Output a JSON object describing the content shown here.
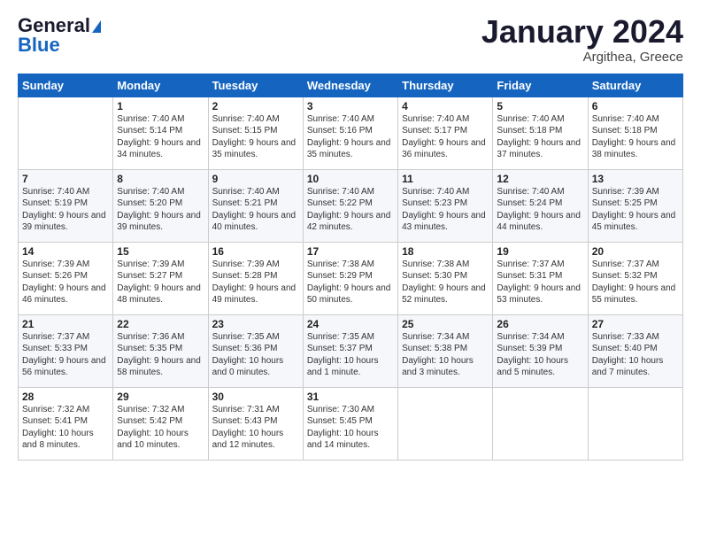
{
  "header": {
    "logo_general": "General",
    "logo_blue": "Blue",
    "month_title": "January 2024",
    "location": "Argithea, Greece"
  },
  "weekdays": [
    "Sunday",
    "Monday",
    "Tuesday",
    "Wednesday",
    "Thursday",
    "Friday",
    "Saturday"
  ],
  "weeks": [
    [
      {
        "day": "",
        "sunrise": "",
        "sunset": "",
        "daylight": ""
      },
      {
        "day": "1",
        "sunrise": "Sunrise: 7:40 AM",
        "sunset": "Sunset: 5:14 PM",
        "daylight": "Daylight: 9 hours and 34 minutes."
      },
      {
        "day": "2",
        "sunrise": "Sunrise: 7:40 AM",
        "sunset": "Sunset: 5:15 PM",
        "daylight": "Daylight: 9 hours and 35 minutes."
      },
      {
        "day": "3",
        "sunrise": "Sunrise: 7:40 AM",
        "sunset": "Sunset: 5:16 PM",
        "daylight": "Daylight: 9 hours and 35 minutes."
      },
      {
        "day": "4",
        "sunrise": "Sunrise: 7:40 AM",
        "sunset": "Sunset: 5:17 PM",
        "daylight": "Daylight: 9 hours and 36 minutes."
      },
      {
        "day": "5",
        "sunrise": "Sunrise: 7:40 AM",
        "sunset": "Sunset: 5:18 PM",
        "daylight": "Daylight: 9 hours and 37 minutes."
      },
      {
        "day": "6",
        "sunrise": "Sunrise: 7:40 AM",
        "sunset": "Sunset: 5:18 PM",
        "daylight": "Daylight: 9 hours and 38 minutes."
      }
    ],
    [
      {
        "day": "7",
        "sunrise": "Sunrise: 7:40 AM",
        "sunset": "Sunset: 5:19 PM",
        "daylight": "Daylight: 9 hours and 39 minutes."
      },
      {
        "day": "8",
        "sunrise": "Sunrise: 7:40 AM",
        "sunset": "Sunset: 5:20 PM",
        "daylight": "Daylight: 9 hours and 39 minutes."
      },
      {
        "day": "9",
        "sunrise": "Sunrise: 7:40 AM",
        "sunset": "Sunset: 5:21 PM",
        "daylight": "Daylight: 9 hours and 40 minutes."
      },
      {
        "day": "10",
        "sunrise": "Sunrise: 7:40 AM",
        "sunset": "Sunset: 5:22 PM",
        "daylight": "Daylight: 9 hours and 42 minutes."
      },
      {
        "day": "11",
        "sunrise": "Sunrise: 7:40 AM",
        "sunset": "Sunset: 5:23 PM",
        "daylight": "Daylight: 9 hours and 43 minutes."
      },
      {
        "day": "12",
        "sunrise": "Sunrise: 7:40 AM",
        "sunset": "Sunset: 5:24 PM",
        "daylight": "Daylight: 9 hours and 44 minutes."
      },
      {
        "day": "13",
        "sunrise": "Sunrise: 7:39 AM",
        "sunset": "Sunset: 5:25 PM",
        "daylight": "Daylight: 9 hours and 45 minutes."
      }
    ],
    [
      {
        "day": "14",
        "sunrise": "Sunrise: 7:39 AM",
        "sunset": "Sunset: 5:26 PM",
        "daylight": "Daylight: 9 hours and 46 minutes."
      },
      {
        "day": "15",
        "sunrise": "Sunrise: 7:39 AM",
        "sunset": "Sunset: 5:27 PM",
        "daylight": "Daylight: 9 hours and 48 minutes."
      },
      {
        "day": "16",
        "sunrise": "Sunrise: 7:39 AM",
        "sunset": "Sunset: 5:28 PM",
        "daylight": "Daylight: 9 hours and 49 minutes."
      },
      {
        "day": "17",
        "sunrise": "Sunrise: 7:38 AM",
        "sunset": "Sunset: 5:29 PM",
        "daylight": "Daylight: 9 hours and 50 minutes."
      },
      {
        "day": "18",
        "sunrise": "Sunrise: 7:38 AM",
        "sunset": "Sunset: 5:30 PM",
        "daylight": "Daylight: 9 hours and 52 minutes."
      },
      {
        "day": "19",
        "sunrise": "Sunrise: 7:37 AM",
        "sunset": "Sunset: 5:31 PM",
        "daylight": "Daylight: 9 hours and 53 minutes."
      },
      {
        "day": "20",
        "sunrise": "Sunrise: 7:37 AM",
        "sunset": "Sunset: 5:32 PM",
        "daylight": "Daylight: 9 hours and 55 minutes."
      }
    ],
    [
      {
        "day": "21",
        "sunrise": "Sunrise: 7:37 AM",
        "sunset": "Sunset: 5:33 PM",
        "daylight": "Daylight: 9 hours and 56 minutes."
      },
      {
        "day": "22",
        "sunrise": "Sunrise: 7:36 AM",
        "sunset": "Sunset: 5:35 PM",
        "daylight": "Daylight: 9 hours and 58 minutes."
      },
      {
        "day": "23",
        "sunrise": "Sunrise: 7:35 AM",
        "sunset": "Sunset: 5:36 PM",
        "daylight": "Daylight: 10 hours and 0 minutes."
      },
      {
        "day": "24",
        "sunrise": "Sunrise: 7:35 AM",
        "sunset": "Sunset: 5:37 PM",
        "daylight": "Daylight: 10 hours and 1 minute."
      },
      {
        "day": "25",
        "sunrise": "Sunrise: 7:34 AM",
        "sunset": "Sunset: 5:38 PM",
        "daylight": "Daylight: 10 hours and 3 minutes."
      },
      {
        "day": "26",
        "sunrise": "Sunrise: 7:34 AM",
        "sunset": "Sunset: 5:39 PM",
        "daylight": "Daylight: 10 hours and 5 minutes."
      },
      {
        "day": "27",
        "sunrise": "Sunrise: 7:33 AM",
        "sunset": "Sunset: 5:40 PM",
        "daylight": "Daylight: 10 hours and 7 minutes."
      }
    ],
    [
      {
        "day": "28",
        "sunrise": "Sunrise: 7:32 AM",
        "sunset": "Sunset: 5:41 PM",
        "daylight": "Daylight: 10 hours and 8 minutes."
      },
      {
        "day": "29",
        "sunrise": "Sunrise: 7:32 AM",
        "sunset": "Sunset: 5:42 PM",
        "daylight": "Daylight: 10 hours and 10 minutes."
      },
      {
        "day": "30",
        "sunrise": "Sunrise: 7:31 AM",
        "sunset": "Sunset: 5:43 PM",
        "daylight": "Daylight: 10 hours and 12 minutes."
      },
      {
        "day": "31",
        "sunrise": "Sunrise: 7:30 AM",
        "sunset": "Sunset: 5:45 PM",
        "daylight": "Daylight: 10 hours and 14 minutes."
      },
      {
        "day": "",
        "sunrise": "",
        "sunset": "",
        "daylight": ""
      },
      {
        "day": "",
        "sunrise": "",
        "sunset": "",
        "daylight": ""
      },
      {
        "day": "",
        "sunrise": "",
        "sunset": "",
        "daylight": ""
      }
    ]
  ]
}
